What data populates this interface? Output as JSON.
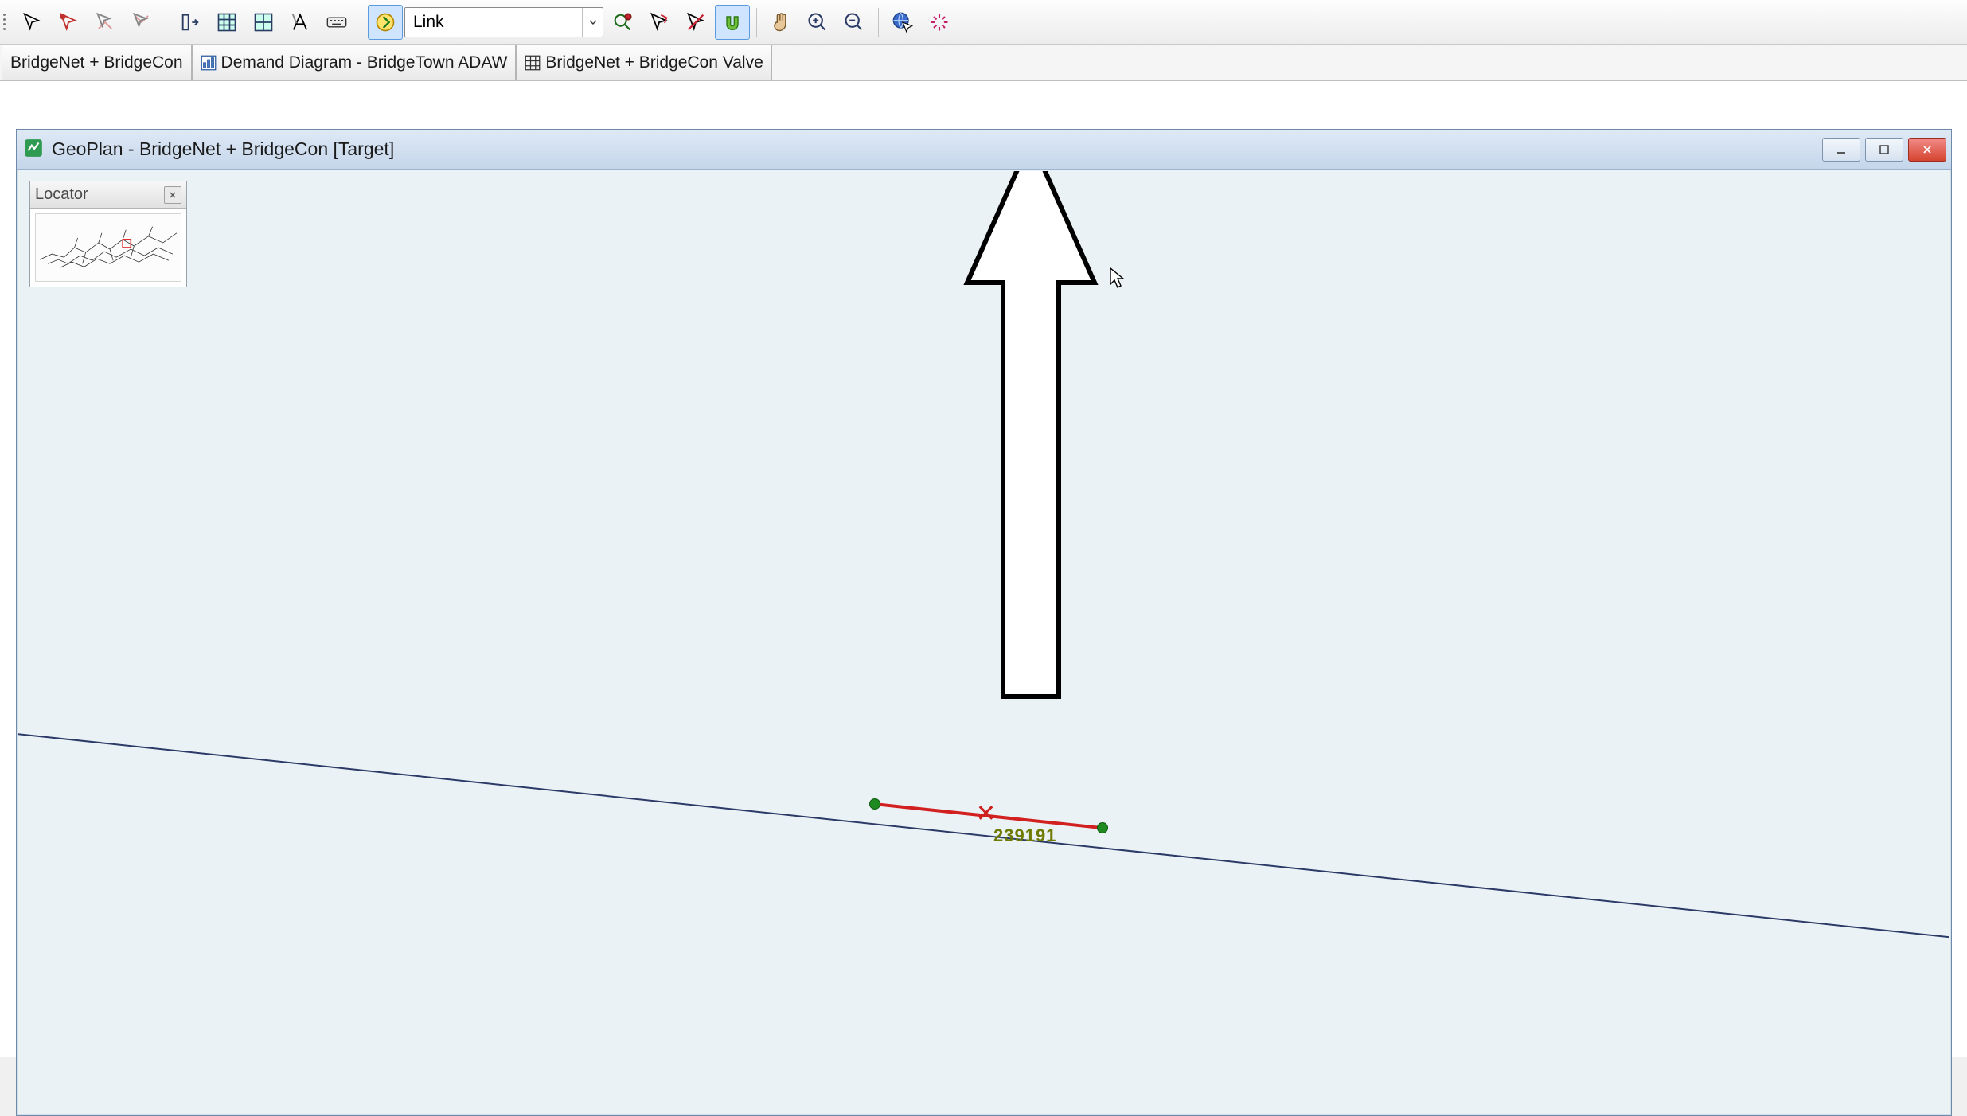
{
  "toolbar": {
    "combo_value": "Link"
  },
  "doc_tabs": [
    {
      "label": "BridgeNet + BridgeCon"
    },
    {
      "label": "Demand Diagram - BridgeTown ADAW"
    },
    {
      "label": "BridgeNet + BridgeCon Valve"
    }
  ],
  "child_window": {
    "title": "GeoPlan - BridgeNet + BridgeCon [Target]"
  },
  "locator": {
    "title": "Locator"
  },
  "map": {
    "selected_link_id": "239191"
  }
}
